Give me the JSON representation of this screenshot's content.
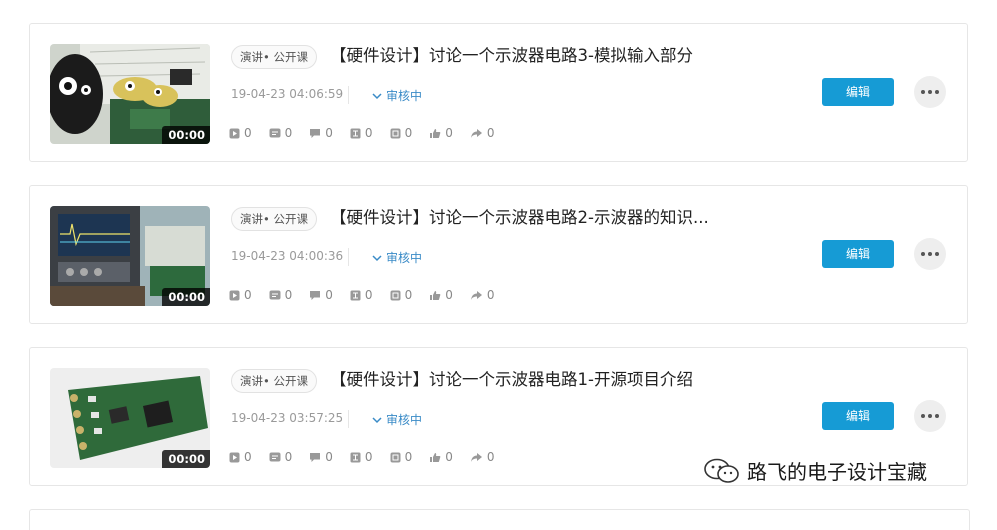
{
  "items": [
    {
      "tag": "演讲• 公开课",
      "title": "【硬件设计】讨论一个示波器电路3-模拟输入部分",
      "date": "19-04-23 04:06:59",
      "status": "审核中",
      "duration": "00:00",
      "stats": [
        "0",
        "0",
        "0",
        "0",
        "0",
        "0",
        "0"
      ],
      "edit_label": "编辑"
    },
    {
      "tag": "演讲• 公开课",
      "title": "【硬件设计】讨论一个示波器电路2-示波器的知识...",
      "date": "19-04-23 04:00:36",
      "status": "审核中",
      "duration": "00:00",
      "stats": [
        "0",
        "0",
        "0",
        "0",
        "0",
        "0",
        "0"
      ],
      "edit_label": "编辑"
    },
    {
      "tag": "演讲• 公开课",
      "title": "【硬件设计】讨论一个示波器电路1-开源项目介绍",
      "date": "19-04-23 03:57:25",
      "status": "审核中",
      "duration": "00:00",
      "stats": [
        "0",
        "0",
        "0",
        "0",
        "0",
        "0",
        "0"
      ],
      "edit_label": "编辑"
    }
  ],
  "stat_icons": [
    "play-icon",
    "danmaku-icon",
    "comment-icon",
    "share-box-icon",
    "collect-icon",
    "like-icon",
    "forward-icon"
  ],
  "watermark": "路飞的电子设计宝藏",
  "colors": {
    "edit_button": "#169bd5",
    "status": "#3a8bc7"
  }
}
